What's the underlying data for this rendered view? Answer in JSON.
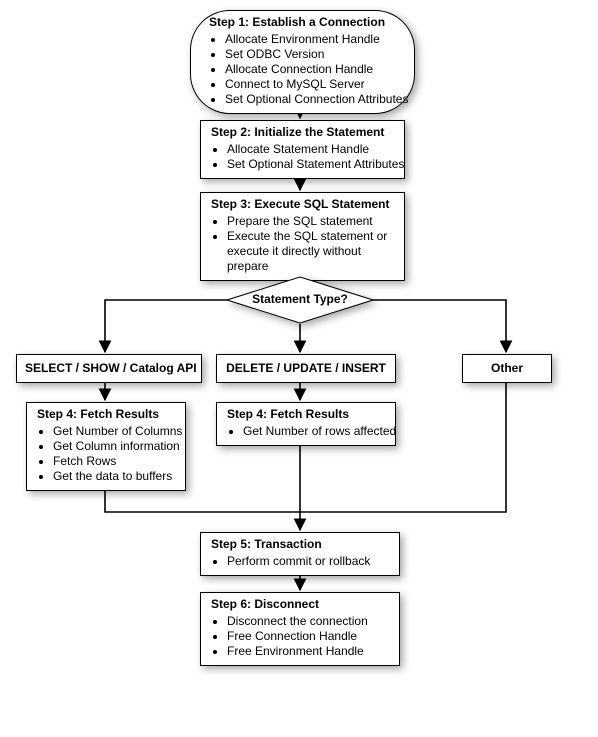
{
  "chart_data": {
    "type": "flowchart",
    "nodes": [
      {
        "id": "step1",
        "shape": "terminator",
        "title": "Step 1: Establish a Connection",
        "bullets": [
          "Allocate Environment Handle",
          "Set ODBC Version",
          "Allocate Connection Handle",
          "Connect to MySQL Server",
          "Set Optional Connection Attributes"
        ]
      },
      {
        "id": "step2",
        "shape": "process",
        "title": "Step 2: Initialize the Statement",
        "bullets": [
          "Allocate Statement Handle",
          "Set Optional Statement Attributes"
        ]
      },
      {
        "id": "step3",
        "shape": "process",
        "title": "Step 3: Execute SQL Statement",
        "bullets": [
          "Prepare the SQL statement",
          "Execute the SQL statement or execute it directly without prepare"
        ]
      },
      {
        "id": "decide",
        "shape": "decision",
        "title": "Statement Type?"
      },
      {
        "id": "bSelect",
        "shape": "process",
        "title": "SELECT / SHOW / Catalog API"
      },
      {
        "id": "bDml",
        "shape": "process",
        "title": "DELETE / UPDATE / INSERT"
      },
      {
        "id": "bOther",
        "shape": "process",
        "title": "Other"
      },
      {
        "id": "step4a",
        "shape": "process",
        "title": "Step 4: Fetch Results",
        "bullets": [
          "Get Number of Columns",
          "Get Column information",
          "Fetch Rows",
          "Get the data to buffers"
        ]
      },
      {
        "id": "step4b",
        "shape": "process",
        "title": "Step 4: Fetch Results",
        "bullets": [
          "Get Number of rows affected"
        ]
      },
      {
        "id": "step5",
        "shape": "process",
        "title": "Step 5: Transaction",
        "bullets": [
          "Perform commit or rollback"
        ]
      },
      {
        "id": "step6",
        "shape": "process",
        "title": "Step 6: Disconnect",
        "bullets": [
          "Disconnect the connection",
          "Free Connection Handle",
          "Free Environment Handle"
        ]
      }
    ],
    "edges": [
      {
        "from": "step1",
        "to": "step2"
      },
      {
        "from": "step2",
        "to": "step3"
      },
      {
        "from": "step3",
        "to": "decide"
      },
      {
        "from": "decide",
        "to": "bSelect"
      },
      {
        "from": "decide",
        "to": "bDml"
      },
      {
        "from": "decide",
        "to": "bOther"
      },
      {
        "from": "bSelect",
        "to": "step4a"
      },
      {
        "from": "bDml",
        "to": "step4b"
      },
      {
        "from": "step4a",
        "to": "step5"
      },
      {
        "from": "step4b",
        "to": "step5"
      },
      {
        "from": "bOther",
        "to": "step5"
      },
      {
        "from": "step5",
        "to": "step6"
      }
    ]
  }
}
